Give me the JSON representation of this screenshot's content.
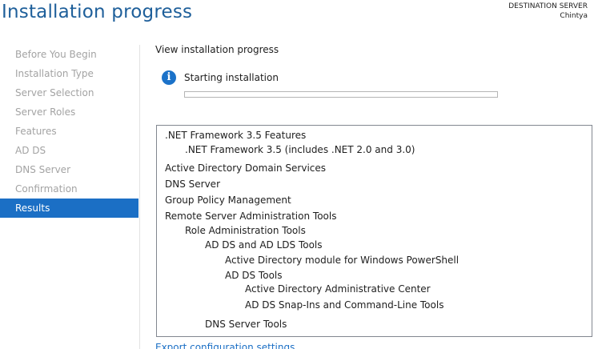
{
  "page": {
    "title": "Installation progress"
  },
  "destination": {
    "label": "DESTINATION SERVER",
    "server": "Chintya"
  },
  "sidebar": {
    "items": [
      {
        "label": "Before You Begin"
      },
      {
        "label": "Installation Type"
      },
      {
        "label": "Server Selection"
      },
      {
        "label": "Server Roles"
      },
      {
        "label": "Features"
      },
      {
        "label": "AD DS"
      },
      {
        "label": "DNS Server"
      },
      {
        "label": "Confirmation"
      },
      {
        "label": "Results"
      }
    ],
    "active_index": 8
  },
  "main": {
    "heading": "View installation progress",
    "status": {
      "icon": "info-icon",
      "text": "Starting installation",
      "progress_percent": 0
    },
    "results": [
      {
        "label": ".NET Framework 3.5 Features",
        "level": 0
      },
      {
        "label": ".NET Framework 3.5 (includes .NET 2.0 and 3.0)",
        "level": 1
      },
      {
        "label": "Active Directory Domain Services",
        "level": 0
      },
      {
        "label": "DNS Server",
        "level": 0
      },
      {
        "label": "Group Policy Management",
        "level": 0
      },
      {
        "label": "Remote Server Administration Tools",
        "level": 0
      },
      {
        "label": "Role Administration Tools",
        "level": 1
      },
      {
        "label": "AD DS and AD LDS Tools",
        "level": 2
      },
      {
        "label": "Active Directory module for Windows PowerShell",
        "level": 3
      },
      {
        "label": "AD DS Tools",
        "level": 3
      },
      {
        "label": "Active Directory Administrative Center",
        "level": 4
      },
      {
        "label": "AD DS Snap-Ins and Command-Line Tools",
        "level": 4
      },
      {
        "label": "DNS Server Tools",
        "level": 2
      }
    ],
    "export_link": "Export configuration settings"
  },
  "colors": {
    "title": "#1e5f9a",
    "accent": "#1b6fc5",
    "disabled_text": "#a3a3a3"
  }
}
